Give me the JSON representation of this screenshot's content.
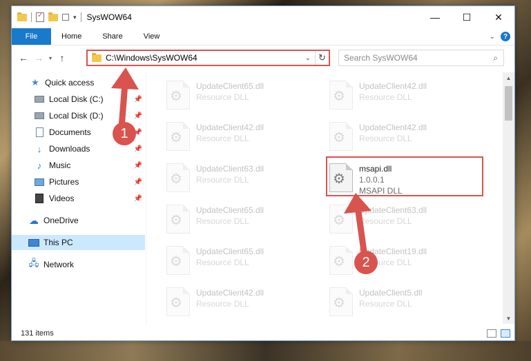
{
  "window": {
    "title": "SysWOW64",
    "controls": {
      "minimize": "—",
      "maximize": "☐",
      "close": "✕"
    }
  },
  "ribbon": {
    "tabs": [
      "File",
      "Home",
      "Share",
      "View"
    ]
  },
  "address": {
    "path": "C:\\Windows\\SysWOW64",
    "search_placeholder": "Search SysWOW64"
  },
  "nav": {
    "items": [
      {
        "label": "Quick access",
        "icon": "star-icon"
      },
      {
        "label": "Local Disk (C:)",
        "icon": "disk-icon",
        "pinned": true
      },
      {
        "label": "Local Disk (D:)",
        "icon": "disk-icon",
        "pinned": true
      },
      {
        "label": "Documents",
        "icon": "documents-icon",
        "pinned": true
      },
      {
        "label": "Downloads",
        "icon": "downloads-icon",
        "pinned": true
      },
      {
        "label": "Music",
        "icon": "music-icon",
        "pinned": true
      },
      {
        "label": "Pictures",
        "icon": "pictures-icon",
        "pinned": true
      },
      {
        "label": "Videos",
        "icon": "videos-icon",
        "pinned": true
      },
      {
        "label": "OneDrive",
        "icon": "onedrive-icon"
      },
      {
        "label": "This PC",
        "icon": "this-pc-icon",
        "selected": true
      },
      {
        "label": "Network",
        "icon": "network-icon"
      }
    ]
  },
  "files": {
    "left": [
      {
        "name": "UpdateClient65.dll",
        "desc": "Resource DLL"
      },
      {
        "name": "UpdateClient42.dll",
        "desc": "Resource DLL"
      },
      {
        "name": "UpdateClient63.dll",
        "desc": "Resource DLL"
      },
      {
        "name": "UpdateClient65.dll",
        "desc": "Resource DLL"
      },
      {
        "name": "UpdateClient65.dll",
        "desc": "Resource DLL"
      },
      {
        "name": "UpdateClient42.dll",
        "desc": "Resource DLL"
      }
    ],
    "right": [
      {
        "name": "UpdateClient42.dll",
        "desc": "Resource DLL"
      },
      {
        "name": "UpdateClient42.dll",
        "desc": "Resource DLL"
      },
      {
        "name": "msapi.dll",
        "version": "1.0.0.1",
        "desc": "MSAPI DLL",
        "highlighted": true
      },
      {
        "name": "UpdateClient63.dll",
        "desc": "Resource DLL"
      },
      {
        "name": "UpdateClient19.dll",
        "desc": "Resource DLL"
      },
      {
        "name": "UpdateClient5.dll",
        "desc": "Resource DLL"
      }
    ]
  },
  "status": {
    "item_count": "131 items"
  },
  "annotations": {
    "callout_1": "1",
    "callout_2": "2",
    "color": "#d9534f"
  }
}
